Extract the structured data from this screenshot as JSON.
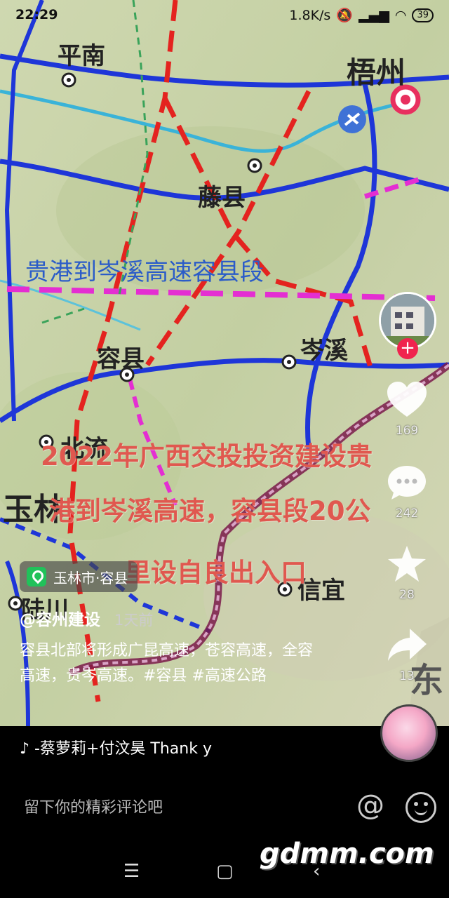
{
  "status_bar": {
    "time": "22:29",
    "network_speed": "1.8K/s",
    "battery": "39"
  },
  "map": {
    "cities": {
      "pingnan": "平南",
      "wuzhou": "梧州",
      "tengxian": "藤县",
      "rongxian": "容县",
      "cenxi": "岑溪",
      "beiliu": "北流",
      "yulin": "玉林",
      "luchuan": "陆川",
      "xinyi": "信宜",
      "dong": "东"
    },
    "headline": "贵港到岑溪高速容县段"
  },
  "caption": {
    "line1": "2022年广西交投投资建设贵",
    "line2": "港到岑溪高速，容县段20公",
    "line3": "里设自良出入口"
  },
  "right_rail": {
    "like_count": "169",
    "comment_count": "242",
    "favorite_count": "28",
    "share_count": "13",
    "follow_symbol": "+"
  },
  "location": {
    "label": "玉林市·容县"
  },
  "post": {
    "author": "@容州建设",
    "time": "1天前",
    "description": "容县北部将形成广昆高速，苍容高速，全容高速，贵岑高速。#容县 #高速公路"
  },
  "music": {
    "text": "♪ -蔡萝莉+付汶昊    Thank y"
  },
  "comment": {
    "placeholder": "留下你的精彩评论吧",
    "at_symbol": "@"
  },
  "watermark": "gdmm.com",
  "colors": {
    "like": "#ffffff",
    "follow": "#f0234e",
    "location_icon": "#21c25a",
    "caption": "#e0584f",
    "headline": "#2b5cc8"
  }
}
